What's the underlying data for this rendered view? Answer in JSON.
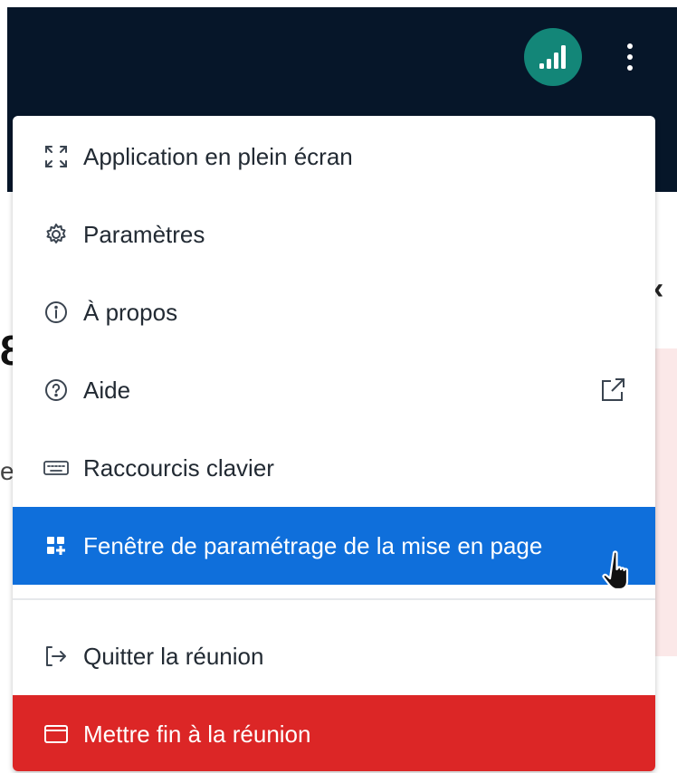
{
  "menu": {
    "items": [
      {
        "label": "Application en plein écran",
        "icon": "fullscreen-icon"
      },
      {
        "label": "Paramètres",
        "icon": "gear-icon"
      },
      {
        "label": "À propos",
        "icon": "info-icon"
      },
      {
        "label": "Aide",
        "icon": "help-icon",
        "trailing_icon": "external-link-icon"
      },
      {
        "label": "Raccourcis clavier",
        "icon": "keyboard-icon"
      },
      {
        "label": "Fenêtre de paramétrage de la mise en page",
        "icon": "layout-grid-icon",
        "state": "hovered"
      },
      {
        "label": "Quitter la réunion",
        "icon": "leave-icon"
      },
      {
        "label": "Mettre fin à la réunion",
        "icon": "end-meeting-icon",
        "variant": "danger"
      }
    ]
  },
  "colors": {
    "topbar": "#061629",
    "connection_status": "#138678",
    "hover_highlight": "#0f6fdb",
    "danger": "#dc2626"
  }
}
